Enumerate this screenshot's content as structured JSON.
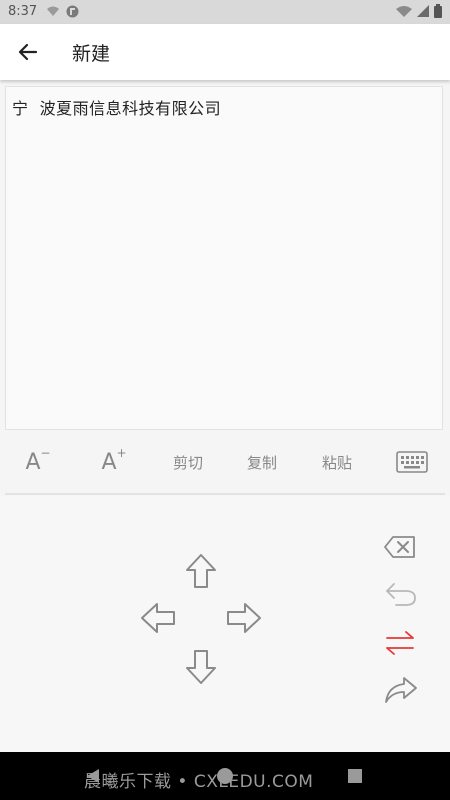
{
  "status_bar": {
    "time": "8:37"
  },
  "app_bar": {
    "title": "新建",
    "back_icon": "arrow-left-icon"
  },
  "editor": {
    "text": "宁  波夏雨信息科技有限公司"
  },
  "toolbar": {
    "font_decrease_label": "A",
    "font_decrease_mark": "−",
    "font_increase_label": "A",
    "font_increase_mark": "+",
    "cut_label": "剪切",
    "copy_label": "复制",
    "paste_label": "粘贴",
    "keyboard_icon": "keyboard-icon"
  },
  "pad": {
    "arrows": [
      "arrow-up-icon",
      "arrow-left-icon",
      "arrow-right-icon",
      "arrow-down-icon"
    ],
    "side": [
      "backspace-icon",
      "undo-icon",
      "swap-icon",
      "share-icon"
    ],
    "swap_color": "#e53935"
  },
  "watermark": "晨曦乐下载  •  CXLEDU.COM"
}
